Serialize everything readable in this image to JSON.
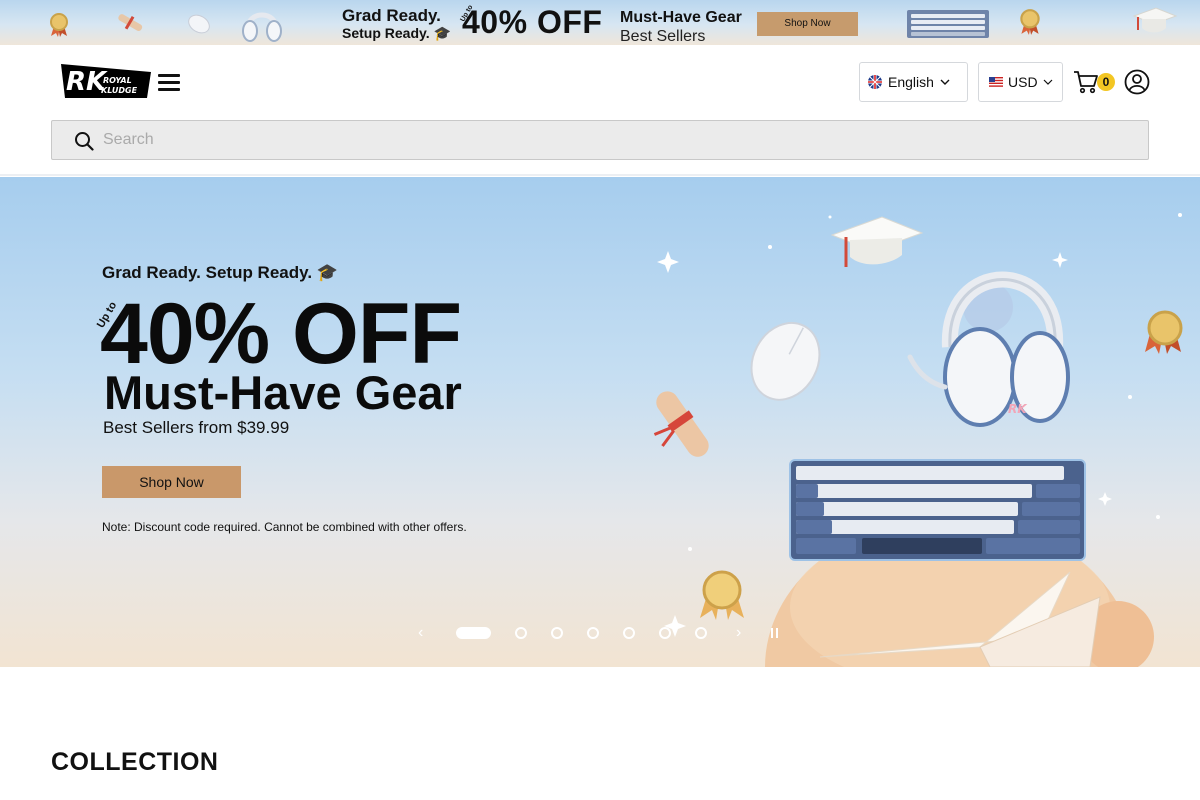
{
  "announcement": {
    "line1": "Grad Ready.",
    "line2": "Setup Ready. 🎓",
    "upto": "Up to",
    "big": "40% OFF",
    "headline": "Must-Have Gear",
    "subline": "Best Sellers",
    "button": "Shop Now"
  },
  "header": {
    "logo_text": [
      "RK",
      "ROYAL",
      "KLUDGE"
    ],
    "language": "English",
    "currency": "USD",
    "cart_count": "0",
    "search_placeholder": "Search"
  },
  "hero": {
    "eyebrow": "Grad Ready. Setup Ready. 🎓",
    "upto": "Up to",
    "discount": "40% OFF",
    "headline": "Must-Have Gear",
    "subline": "Best Sellers from $39.99",
    "cta": "Shop Now",
    "note": "Note: Discount code required. Cannot be combined with other offers.",
    "slides": 7,
    "active_slide": 1,
    "accent_color": "#c9986a"
  },
  "section": {
    "title": "COLLECTION"
  },
  "icons": {
    "menu": "hamburger-menu-icon",
    "flag_lang": "uk-flag-icon",
    "flag_curr": "us-flag-icon",
    "cart": "cart-icon",
    "account": "user-icon",
    "search": "search-icon"
  }
}
